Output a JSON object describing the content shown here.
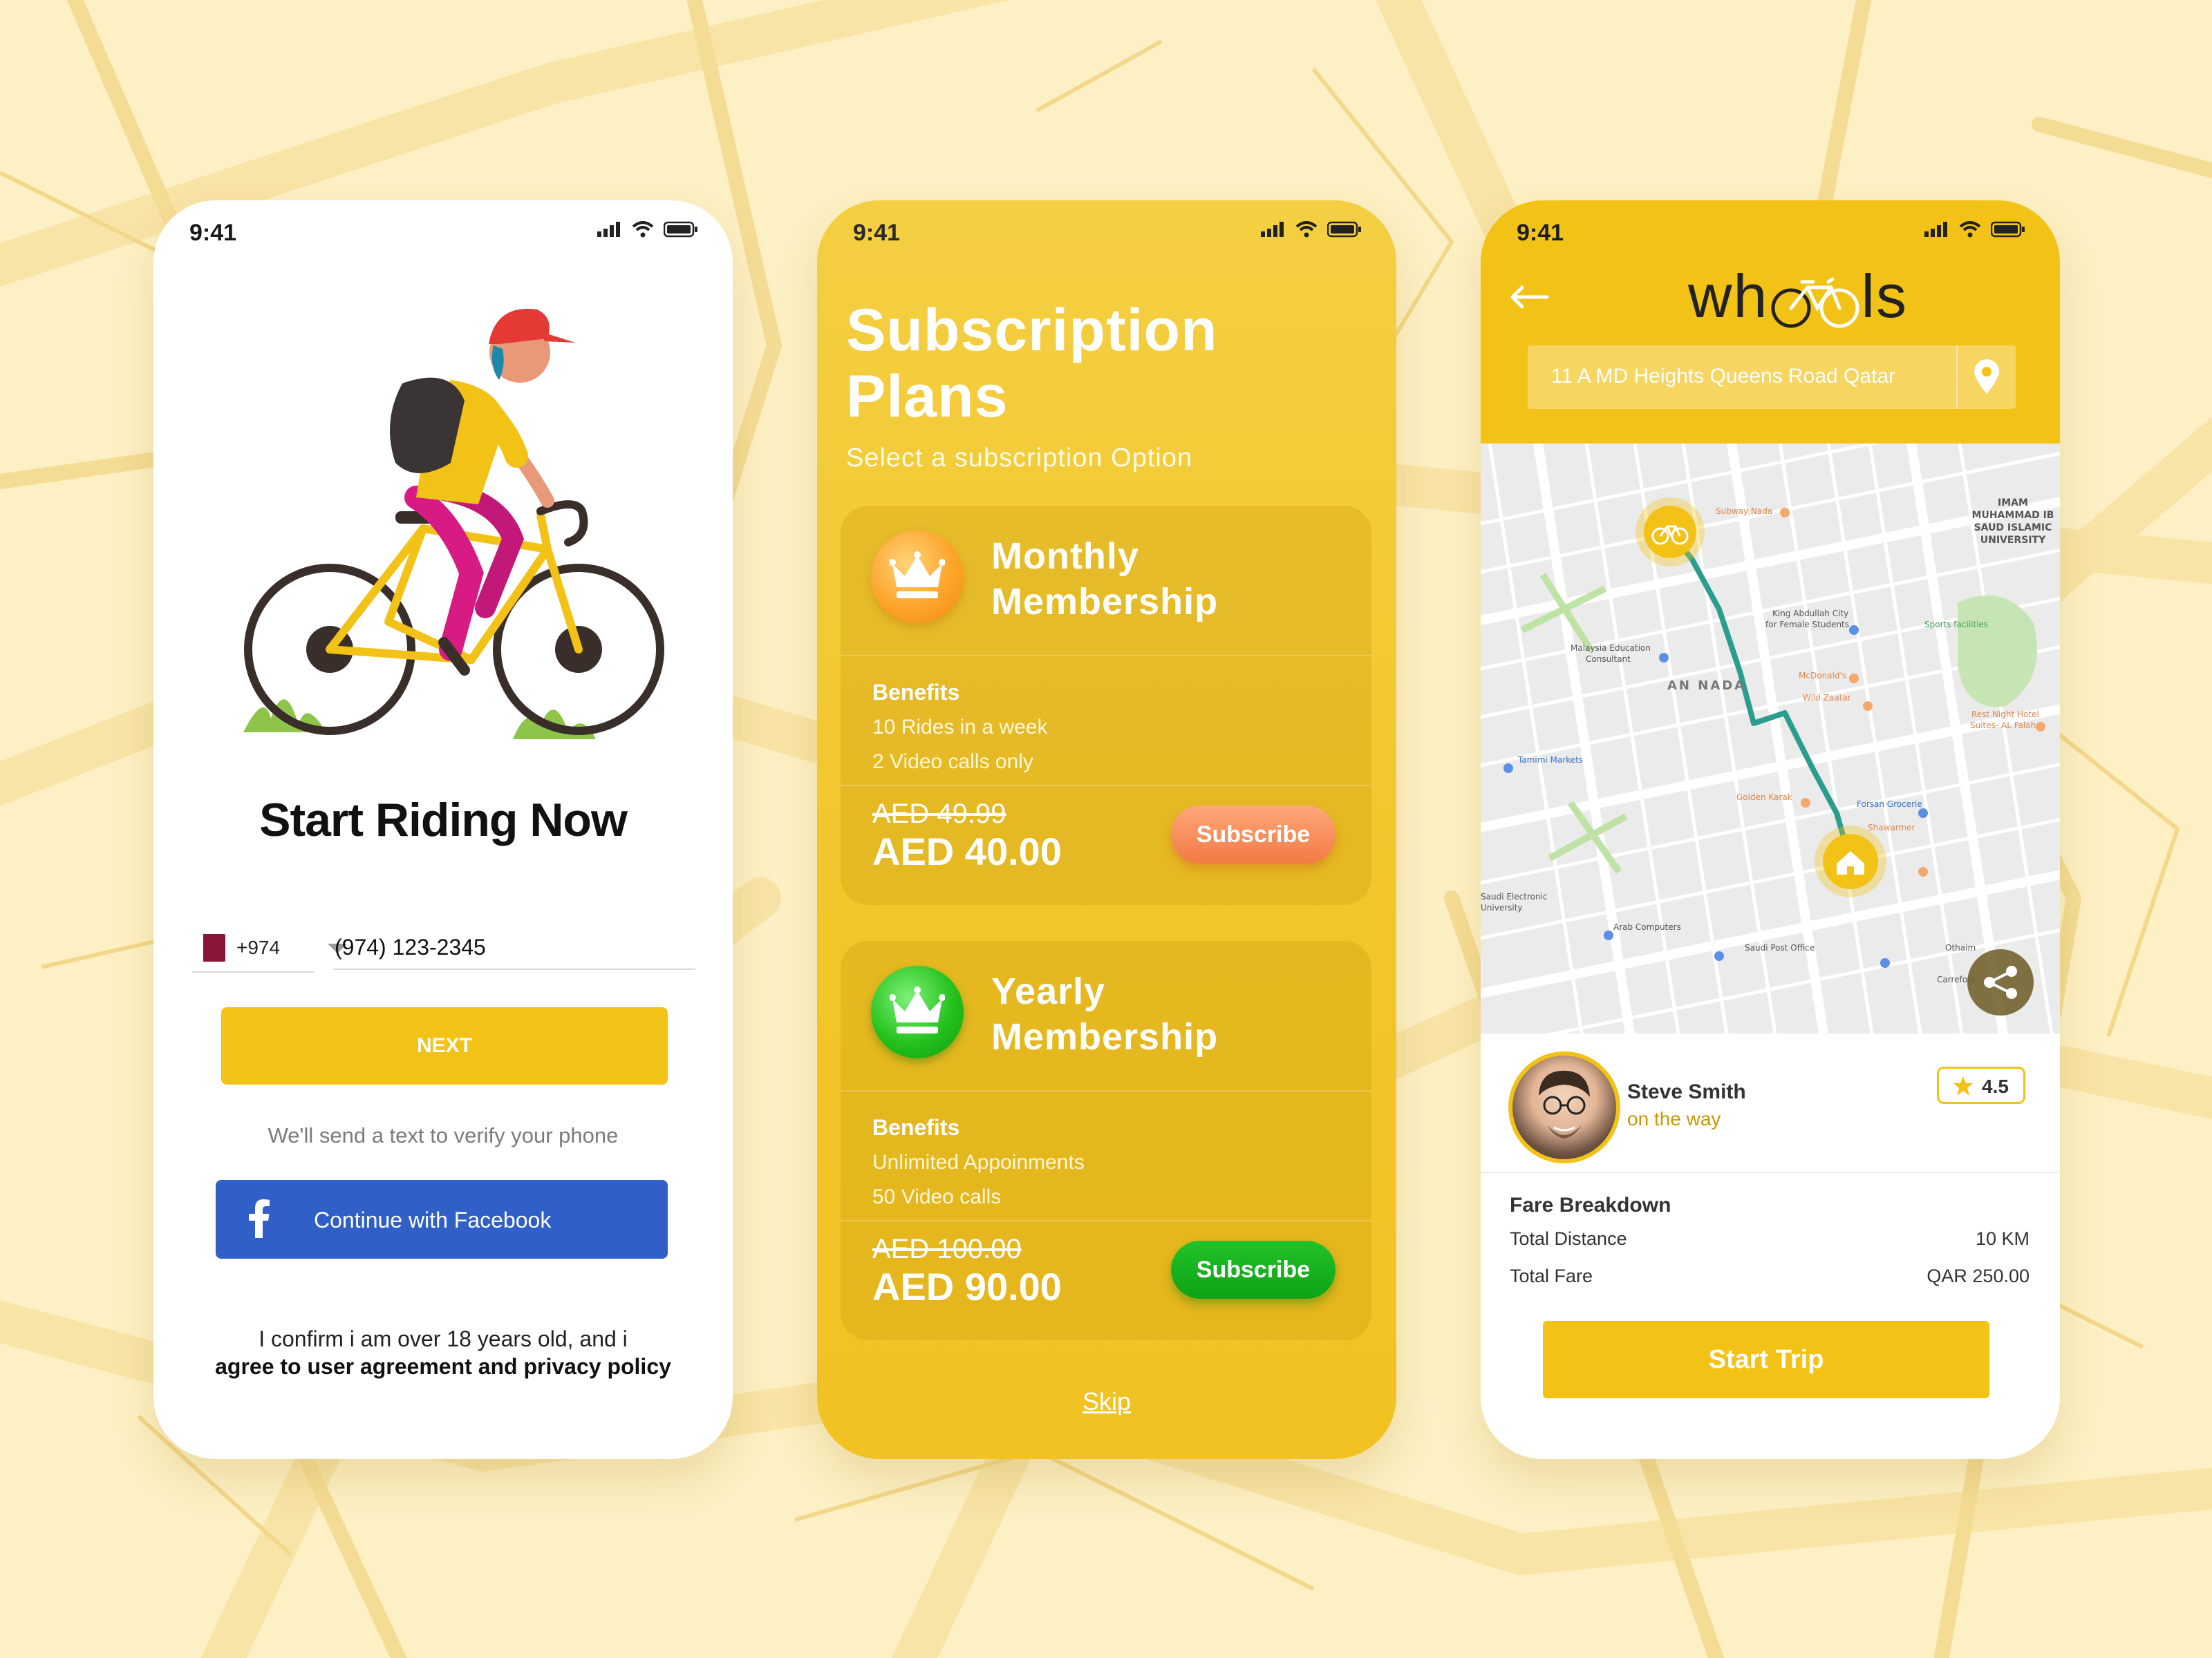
{
  "colors": {
    "accent": "#f2c216",
    "facebook": "#2f5fc7",
    "orange": "#f27a45",
    "green": "#0ea215",
    "route": "#2a9d8f"
  },
  "phones": {
    "signup": {
      "status_time": "9:41",
      "title": "Start Riding Now",
      "country_code": "+974",
      "phone_value": "(974) 123-2345",
      "next_label": "NEXT",
      "hint": "We'll send a text to verify your phone",
      "facebook_label": "Continue with Facebook",
      "legal_line1": "I confirm i am over 18 years old, and i",
      "legal_line2": "agree to user agreement and privacy policy"
    },
    "subscription": {
      "status_time": "9:41",
      "title_line1": "Subscription",
      "title_line2": "Plans",
      "subtitle": "Select a subscription Option",
      "plans": [
        {
          "name_line1": "Monthly",
          "name_line2": "Membership",
          "badge_icon": "crown-icon",
          "benefits_heading": "Benefits",
          "benefits": [
            "10 Rides in a week",
            "2 Video calls only"
          ],
          "old_price": "AED 49.99",
          "price": "AED 40.00",
          "cta": "Subscribe"
        },
        {
          "name_line1": "Yearly",
          "name_line2": "Membership",
          "badge_icon": "crown-icon",
          "benefits_heading": "Benefits",
          "benefits": [
            "Unlimited Appoinments",
            "50 Video calls"
          ],
          "old_price": "AED 100.00",
          "price": "AED 90.00",
          "cta": "Subscribe"
        }
      ],
      "skip_label": "Skip"
    },
    "trip": {
      "status_time": "9:41",
      "logo_prefix": "wh",
      "logo_suffix": "ls",
      "address": "11 A MD Heights Queens Road Qatar",
      "map_labels": {
        "university": [
          "IMAM",
          "MUHAMMAD IB",
          "SAUD ISLAMIC",
          "UNIVERSITY"
        ],
        "places": [
          "Subway Nada",
          "King Abdullah City",
          "for Female Students",
          "Malaysia Education",
          "Consultant",
          "McDonald's",
          "Wild Zaatar",
          "Sports facilities",
          "Rest Night Hotel",
          "Suites- AL Falah",
          "Tamimi Markets",
          "Golden Karak",
          "Forsan Grocerie",
          "Shawarmer",
          "Arab Computers",
          "Saudi Post Office",
          "Othaim",
          "Carrefour",
          "Saudi Electronic",
          "University"
        ],
        "district": "AN NADA"
      },
      "driver_name": "Steve Smith",
      "driver_status": "on the way",
      "rating": "4.5",
      "fare_heading": "Fare Breakdown",
      "fare_rows": [
        {
          "label": "Total Distance",
          "value": "10 KM"
        },
        {
          "label": "Total Fare",
          "value": "QAR 250.00"
        }
      ],
      "start_label": "Start Trip"
    }
  }
}
